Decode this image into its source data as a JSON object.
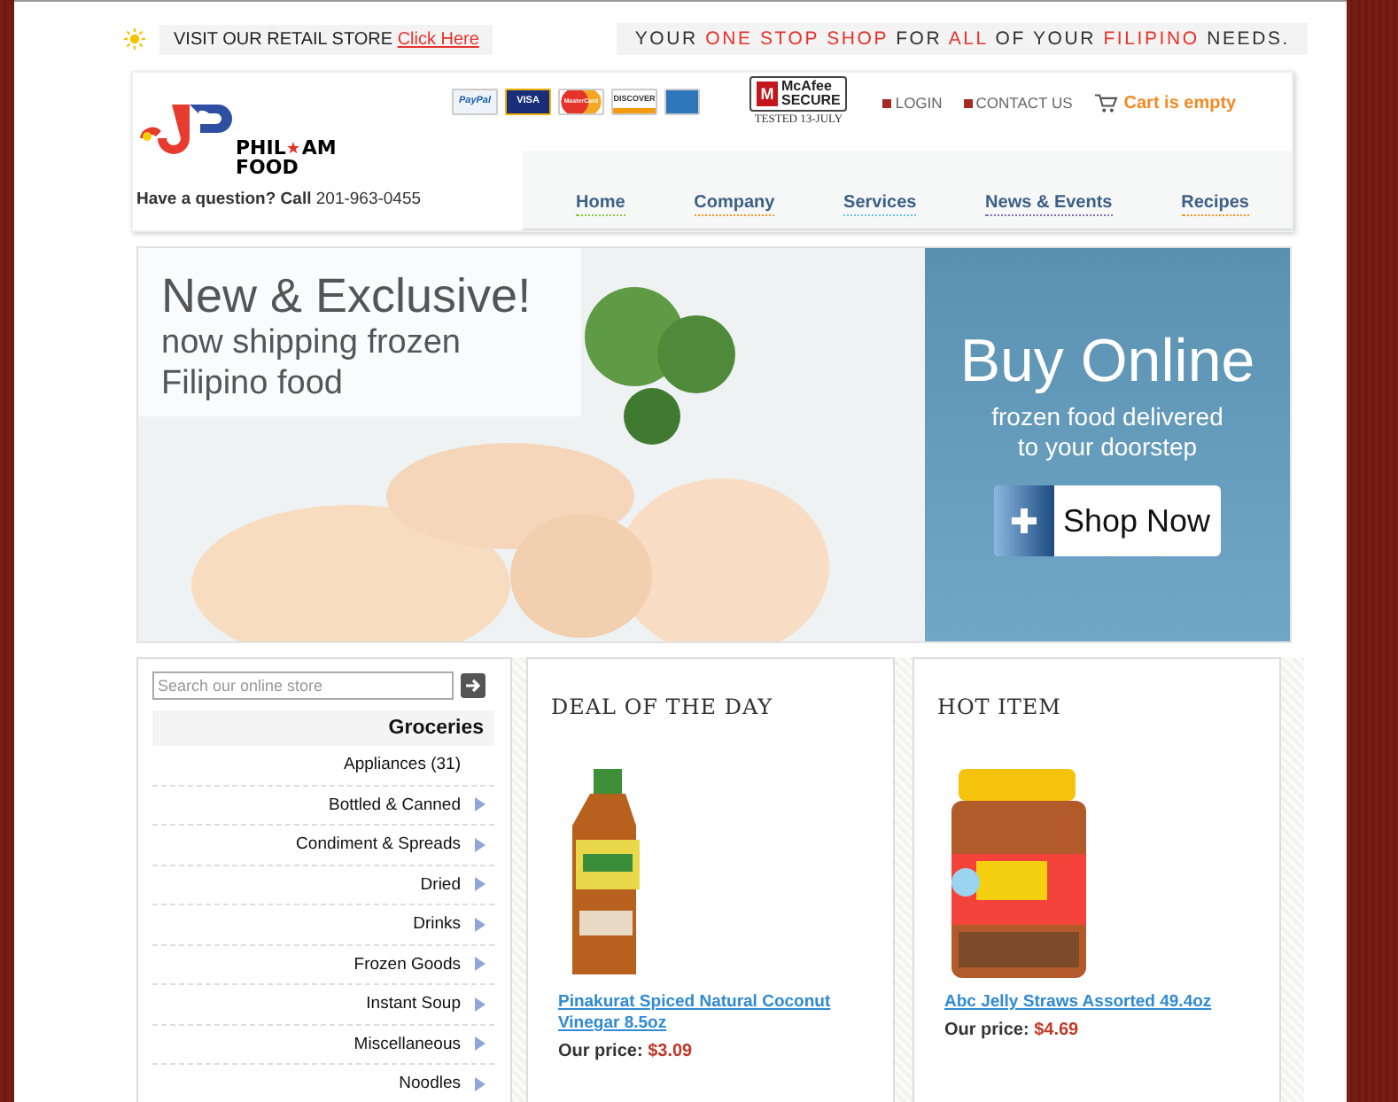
{
  "top_bar": {
    "store_text": "VISIT OUR RETAIL STORE",
    "store_link": "Click Here",
    "tagline": [
      {
        "text": "YOUR",
        "highlight": false
      },
      {
        "text": "ONE STOP SHOP",
        "highlight": true
      },
      {
        "text": "FOR",
        "highlight": false
      },
      {
        "text": "ALL",
        "highlight": true
      },
      {
        "text": "OF YOUR",
        "highlight": false
      },
      {
        "text": "FILIPINO",
        "highlight": true
      },
      {
        "text": "NEEDS.",
        "highlight": false
      }
    ]
  },
  "header": {
    "logo": {
      "line1a": "PHIL",
      "line1b": "AM",
      "line2": "FOOD"
    },
    "question": "Have a question? Call",
    "phone": "201-963-0455",
    "payment_cards": [
      {
        "kind": "paypal",
        "label": "PayPal"
      },
      {
        "kind": "visa",
        "label": "VISA"
      },
      {
        "kind": "mastercard",
        "label": "MasterCard"
      },
      {
        "kind": "discover",
        "label": "DISCOVER"
      },
      {
        "kind": "amex"
      }
    ],
    "security": {
      "shield_letter": "M",
      "brand": "McAfee",
      "word": "SECURE",
      "tested": "TESTED 13-JULY"
    },
    "links": [
      "LOGIN",
      "CONTACT US"
    ],
    "cart": "Cart is empty",
    "nav": [
      {
        "label": "Home",
        "color": "#8cc63f"
      },
      {
        "label": "Company",
        "color": "#f7931e"
      },
      {
        "label": "Services",
        "color": "#6ac2e6"
      },
      {
        "label": "News & Events",
        "color": "#8c6bb1"
      },
      {
        "label": "Recipes",
        "color": "#f7931e"
      }
    ]
  },
  "banner": {
    "headline": "New & Exclusive!",
    "subline": "now shipping frozen\nFilipino food",
    "promo_title": "Buy Online",
    "promo_text": "frozen food delivered\nto your doorstep",
    "button": "Shop Now"
  },
  "sidebar": {
    "search_placeholder": "Search our online store",
    "heading": "Groceries",
    "categories": [
      {
        "label": "Appliances (31)",
        "submenu": false
      },
      {
        "label": "Bottled & Canned",
        "submenu": true
      },
      {
        "label": "Condiment & Spreads",
        "submenu": true
      },
      {
        "label": "Dried",
        "submenu": true
      },
      {
        "label": "Drinks",
        "submenu": true
      },
      {
        "label": "Frozen Goods",
        "submenu": true
      },
      {
        "label": "Instant Soup",
        "submenu": true
      },
      {
        "label": "Miscellaneous",
        "submenu": true
      },
      {
        "label": "Noodles",
        "submenu": true
      }
    ]
  },
  "panels": [
    {
      "title": "DEAL OF THE DAY",
      "product": {
        "kind": "bottle",
        "name": "Pinakurat Spiced Natural Coconut Vinegar 8.5oz",
        "price_label": "Our price:",
        "price": "$3.09"
      }
    },
    {
      "title": "HOT ITEM",
      "product": {
        "kind": "jar",
        "name": "Abc Jelly Straws Assorted 49.4oz",
        "price_label": "Our price:",
        "price": "$4.69"
      }
    }
  ]
}
